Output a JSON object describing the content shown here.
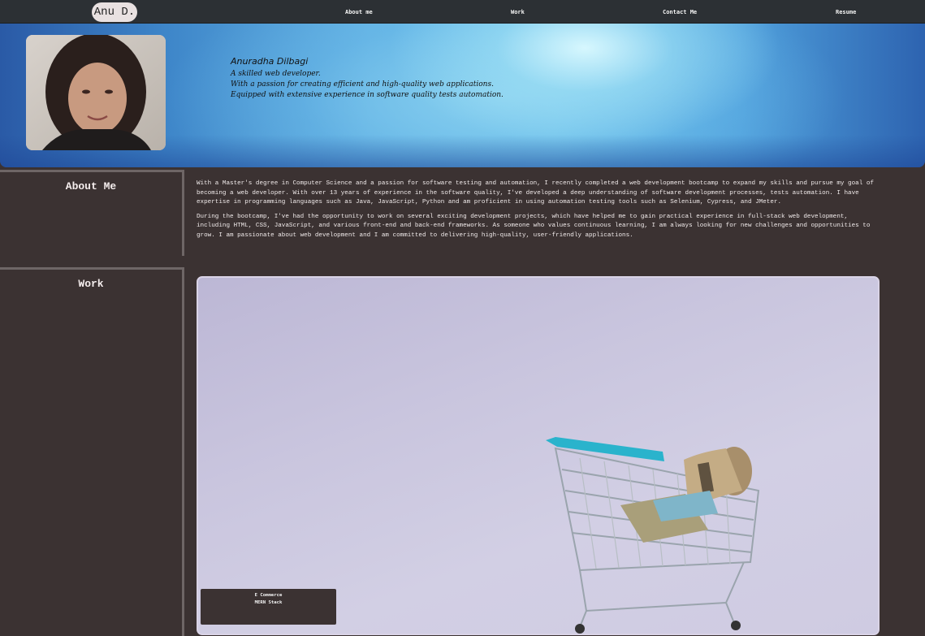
{
  "nav": {
    "brand": "Anu D.",
    "links": [
      "About me",
      "Work",
      "Contact Me",
      "Resume"
    ]
  },
  "hero": {
    "name": "Anuradha Dilbagi",
    "lines": [
      "A skilled web developer.",
      "With a passion for creating efficient and high-quality web applications.",
      "Equipped with extensive experience in software quality tests automation."
    ]
  },
  "about": {
    "heading": "About Me",
    "paragraphs": [
      "With a Master's degree in Computer Science and a passion for software testing and automation, I recently completed a web development bootcamp to expand my skills and pursue my goal of becoming a web developer. With over 13 years of experience in the software quality, I've developed a deep understanding of software development processes, tests automation. I have expertise in programming languages such as Java, JavaScript, Python and am proficient in using automation testing tools such as Selenium, Cypress, and JMeter.",
      "During the bootcamp, I've had the opportunity to work on several exciting development projects, which have helped me to gain practical experience in full-stack web development, including HTML, CSS, JavaScript, and various front-end and back-end frameworks. As someone who values continuous learning, I am always looking for new challenges and opportunities to grow. I am passionate about web development and I am committed to delivering high-quality, user-friendly applications."
    ]
  },
  "work": {
    "heading": "Work",
    "project": {
      "title": "E Commerce",
      "subtitle": "MERN Stack"
    }
  },
  "colors": {
    "page_bg": "#3b3232",
    "nav_bg": "#2c3034",
    "card_bg": "#cfcbe2",
    "cart_accent": "#2ab3cc"
  }
}
